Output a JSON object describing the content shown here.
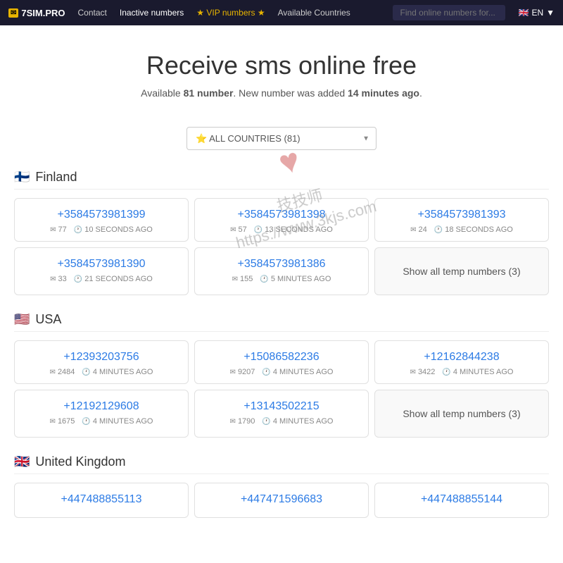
{
  "brand": {
    "icon": "✉",
    "name": "7SIM.PRO"
  },
  "nav": {
    "links": [
      {
        "label": "Contact",
        "key": "contact",
        "class": ""
      },
      {
        "label": "Inactive numbers",
        "key": "inactive",
        "class": ""
      },
      {
        "label": "★ VIP numbers ★",
        "key": "vip",
        "class": "vip"
      },
      {
        "label": "Available Countries",
        "key": "countries",
        "class": ""
      }
    ],
    "search_placeholder": "Find online numbers for...",
    "lang": "EN"
  },
  "hero": {
    "title": "Receive sms online free",
    "subtitle_pre": "Available ",
    "subtitle_count": "81 number",
    "subtitle_mid": ". New number was added ",
    "subtitle_time": "14 minutes ago",
    "subtitle_post": "."
  },
  "selector": {
    "value": "⭐ ALL COUNTRIES (81)",
    "options": [
      "ALL COUNTRIES (81)"
    ]
  },
  "sections": [
    {
      "country": "Finland",
      "flag": "🇫🇮",
      "numbers": [
        {
          "phone": "+3584573981399",
          "msgs": "77",
          "time": "10 SECONDS AGO"
        },
        {
          "phone": "+3584573981398",
          "msgs": "57",
          "time": "13 SECONDS AGO"
        },
        {
          "phone": "+3584573981393",
          "msgs": "24",
          "time": "18 SECONDS AGO"
        },
        {
          "phone": "+3584573981390",
          "msgs": "33",
          "time": "21 SECONDS AGO"
        },
        {
          "phone": "+3584573981386",
          "msgs": "155",
          "time": "5 MINUTES AGO"
        },
        {
          "phone": null,
          "show_temp": true,
          "temp_count": 3
        }
      ]
    },
    {
      "country": "USA",
      "flag": "🇺🇸",
      "numbers": [
        {
          "phone": "+12393203756",
          "msgs": "2484",
          "time": "4 MINUTES AGO"
        },
        {
          "phone": "+15086582236",
          "msgs": "9207",
          "time": "4 MINUTES AGO"
        },
        {
          "phone": "+12162844238",
          "msgs": "3422",
          "time": "4 MINUTES AGO"
        },
        {
          "phone": "+12192129608",
          "msgs": "1675",
          "time": "4 MINUTES AGO"
        },
        {
          "phone": "+13143502215",
          "msgs": "1790",
          "time": "4 MINUTES AGO"
        },
        {
          "phone": null,
          "show_temp": true,
          "temp_count": 3
        }
      ]
    },
    {
      "country": "United Kingdom",
      "flag": "🇬🇧",
      "numbers": [
        {
          "phone": "+447488855113",
          "msgs": "",
          "time": ""
        },
        {
          "phone": "+447471596683",
          "msgs": "",
          "time": ""
        },
        {
          "phone": "+447488855144",
          "msgs": "",
          "time": ""
        }
      ]
    }
  ],
  "show_temp_label": "Show all temp numbers",
  "watermark": {
    "line1": "技技师",
    "line2": "https://www.3kjs.com"
  }
}
